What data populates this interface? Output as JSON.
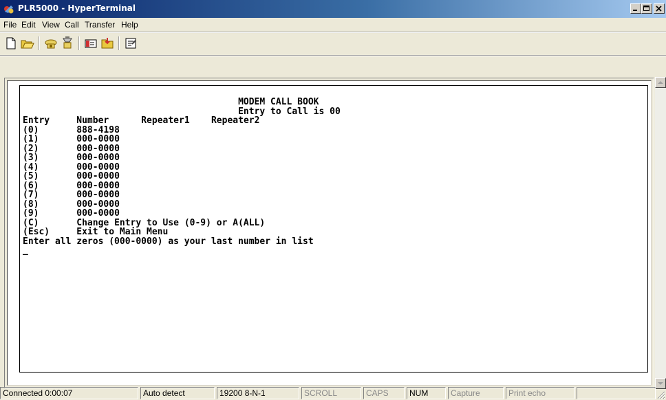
{
  "window": {
    "title": "PLR5000 - HyperTerminal"
  },
  "menu": {
    "items": [
      "File",
      "Edit",
      "View",
      "Call",
      "Transfer",
      "Help"
    ]
  },
  "toolbar": {
    "icons": [
      "new-file-icon",
      "open-file-icon",
      "connect-phone-icon",
      "disconnect-phone-icon",
      "send-icon",
      "receive-icon",
      "properties-icon"
    ]
  },
  "terminal": {
    "header1": "MODEM CALL BOOK",
    "header2": "Entry to Call is 00",
    "columns": {
      "entry": "Entry",
      "number": "Number",
      "repeater1": "Repeater1",
      "repeater2": "Repeater2"
    },
    "rows": [
      {
        "entry": "(0)",
        "number": "888-4198"
      },
      {
        "entry": "(1)",
        "number": "000-0000"
      },
      {
        "entry": "(2)",
        "number": "000-0000"
      },
      {
        "entry": "(3)",
        "number": "000-0000"
      },
      {
        "entry": "(4)",
        "number": "000-0000"
      },
      {
        "entry": "(5)",
        "number": "000-0000"
      },
      {
        "entry": "(6)",
        "number": "000-0000"
      },
      {
        "entry": "(7)",
        "number": "000-0000"
      },
      {
        "entry": "(8)",
        "number": "000-0000"
      },
      {
        "entry": "(9)",
        "number": "000-0000"
      }
    ],
    "option_c": {
      "key": "(C)",
      "text": "Change Entry to Use (0-9) or A(ALL)"
    },
    "option_esc": {
      "key": "(Esc)",
      "text": "Exit to Main Menu"
    },
    "note": "Enter all zeros (000-0000) as your last number in list",
    "cursor": "_"
  },
  "status": {
    "connected": "Connected 0:00:07",
    "detect": "Auto detect",
    "settings": "19200 8-N-1",
    "scroll": "SCROLL",
    "caps": "CAPS",
    "num": "NUM",
    "capture": "Capture",
    "print_echo": "Print echo"
  }
}
